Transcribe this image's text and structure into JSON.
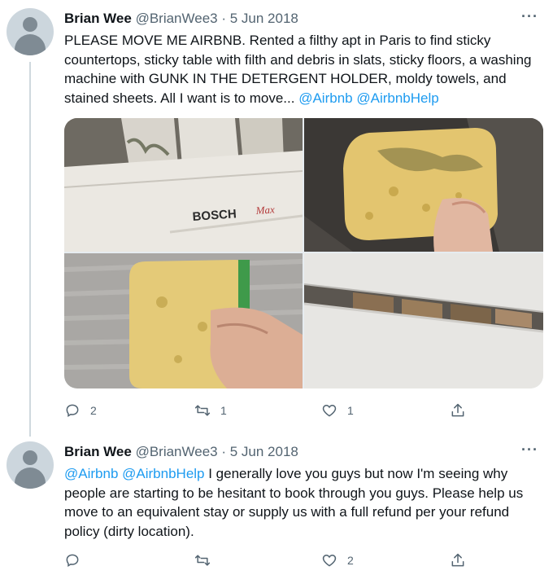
{
  "tweets": [
    {
      "author_name": "Brian Wee",
      "handle": "@BrianWee3",
      "separator": "·",
      "date": "5 Jun 2018",
      "text_plain": "PLEASE MOVE ME AIRBNB. Rented a filthy apt in Paris to find sticky countertops, sticky table with filth and debris in slats, sticky floors, a washing machine with GUNK IN THE DETERGENT HOLDER, moldy towels, and stained sheets. All I want is to move... ",
      "mention_1": "@Airbnb",
      "mention_2": "@AirbnbHelp",
      "media": {
        "photo_1_brand": "BOSCH",
        "photo_1_model": "Max"
      },
      "actions": {
        "reply_count": "2",
        "retweet_count": "1",
        "like_count": "1"
      }
    },
    {
      "author_name": "Brian Wee",
      "handle": "@BrianWee3",
      "separator": "·",
      "date": "5 Jun 2018",
      "mention_1": "@Airbnb",
      "mention_2": "@AirbnbHelp",
      "text_plain": " I generally love you guys but now I'm seeing why people are starting to be hesitant to book through you guys. Please help us move to an equivalent stay or supply us with a full refund per your refund policy (dirty location).",
      "actions": {
        "reply_count": "",
        "retweet_count": "",
        "like_count": "2"
      }
    }
  ],
  "more_icon_glyph": "···",
  "colors": {
    "accent": "#1d9bf0",
    "text": "#0f1419",
    "secondary": "#536471",
    "thread_line": "#cfd9de"
  }
}
